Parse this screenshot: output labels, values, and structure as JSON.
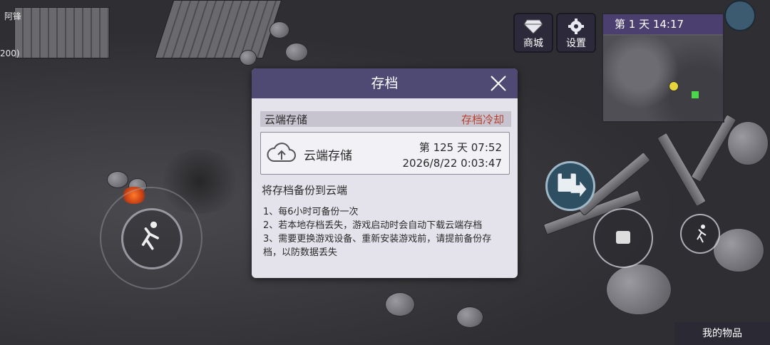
{
  "hud": {
    "player_name": "阿锋",
    "player_count": "200)",
    "shop_label": "商城",
    "settings_label": "设置",
    "day_time": "第 1 天  14:17",
    "items_label": "我的物品"
  },
  "dialog": {
    "title": "存档",
    "section_label": "云端存储",
    "cooldown_label": "存档冷却",
    "card_title": "云端存储",
    "card_day": "第 125 天   07:52",
    "card_datetime": "2026/8/22 0:03:47",
    "description": "将存档备份到云端",
    "rules": [
      "1、每6小时可备份一次",
      "2、若本地存档丢失，游戏启动时会自动下载云端存档",
      "3、需要更换游戏设备、重新安装游戏前，请提前备份存档，以防数据丢失"
    ]
  },
  "colors": {
    "header_purple": "#4f4a74",
    "cooldown_red": "#b5422e",
    "dialog_bg": "#e4e2ea"
  }
}
